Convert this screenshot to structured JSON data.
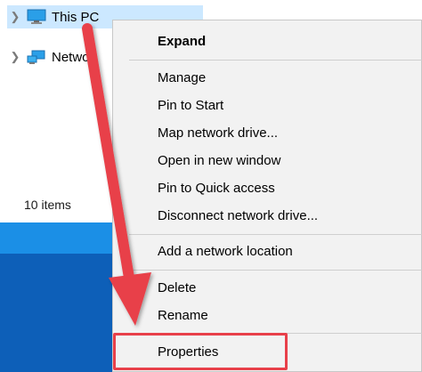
{
  "nav": {
    "items": [
      {
        "label": "This PC",
        "icon": "computer-icon",
        "selected": true
      },
      {
        "label": "Netwo",
        "icon": "network-icon",
        "selected": false
      }
    ]
  },
  "status": {
    "items_count": "10 items"
  },
  "context_menu": {
    "items": [
      {
        "label": "Expand",
        "bold": true
      },
      {
        "label": "Manage"
      },
      {
        "label": "Pin to Start"
      },
      {
        "label": "Map network drive..."
      },
      {
        "label": "Open in new window"
      },
      {
        "label": "Pin to Quick access"
      },
      {
        "label": "Disconnect network drive..."
      },
      {
        "label": "Add a network location"
      },
      {
        "label": "Delete"
      },
      {
        "label": "Rename"
      },
      {
        "label": "Properties",
        "highlighted": true
      }
    ]
  },
  "colors": {
    "selection": "#cce8ff",
    "annotation_arrow": "#e8404a",
    "desktop_blue": "#1b8fe6"
  }
}
